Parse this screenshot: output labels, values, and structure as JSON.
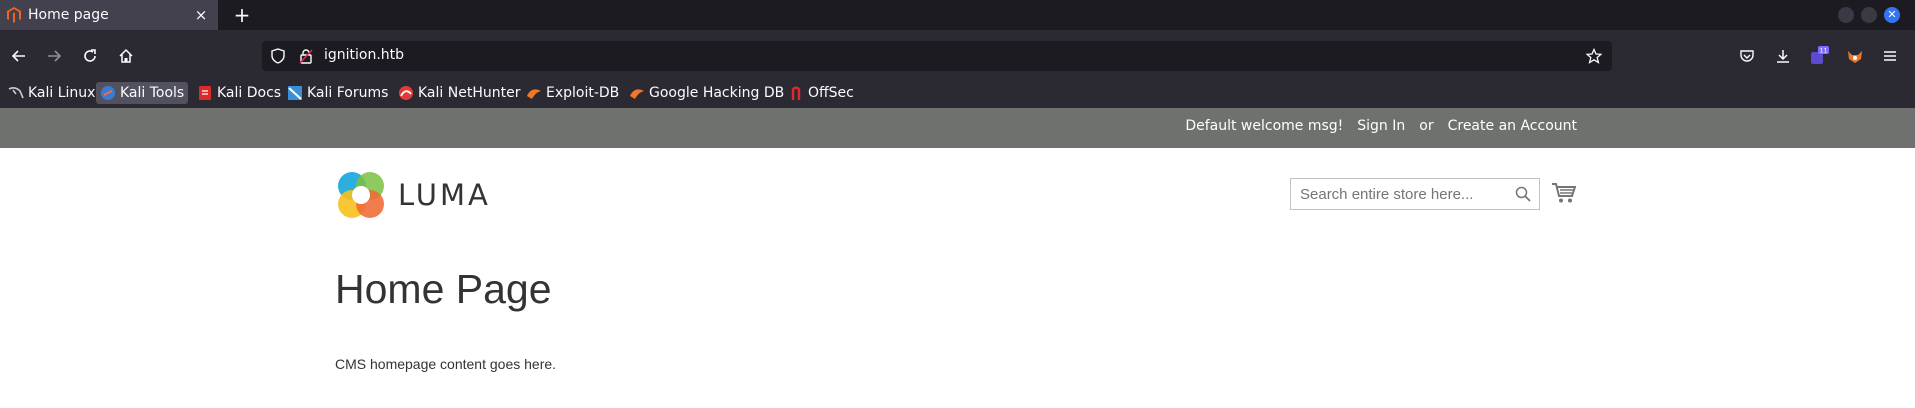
{
  "browser": {
    "tab": {
      "title": "Home page",
      "close_glyph": "×",
      "favicon": "magento-icon"
    },
    "new_tab_glyph": "+",
    "url": "ignition.htb",
    "bookmarks": [
      {
        "label": "Kali Linux",
        "icon": "kali-dragon-icon"
      },
      {
        "label": "Kali Tools",
        "icon": "kali-tools-icon",
        "active": true
      },
      {
        "label": "Kali Docs",
        "icon": "kali-docs-icon"
      },
      {
        "label": "Kali Forums",
        "icon": "kali-forums-icon"
      },
      {
        "label": "Kali NetHunter",
        "icon": "nethunter-icon"
      },
      {
        "label": "Exploit-DB",
        "icon": "exploit-db-icon"
      },
      {
        "label": "Google Hacking DB",
        "icon": "ghdb-icon"
      },
      {
        "label": "OffSec",
        "icon": "offsec-icon"
      }
    ],
    "extension_badge": "11"
  },
  "header": {
    "welcome": "Default welcome msg!",
    "sign_in": "Sign In",
    "or": "or",
    "create_account": "Create an Account"
  },
  "logo": {
    "text": "LUMA"
  },
  "search": {
    "placeholder": "Search entire store here..."
  },
  "main": {
    "title": "Home Page",
    "content": "CMS homepage content goes here."
  },
  "colors": {
    "tab_active": "#42414d",
    "chrome_dark": "#1c1b22",
    "chrome": "#2b2a33",
    "panel_header": "#6e716e",
    "text": "#333333"
  }
}
